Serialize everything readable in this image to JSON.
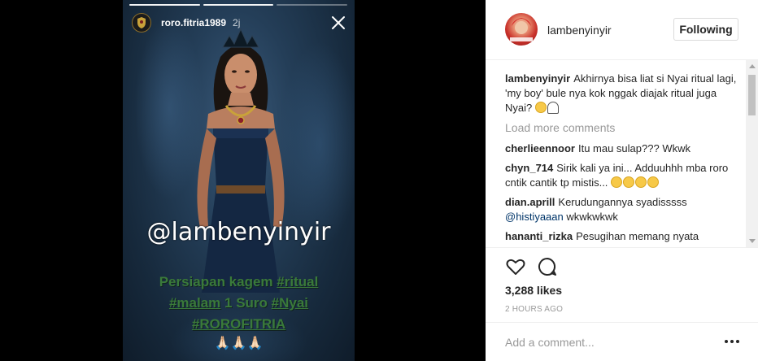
{
  "story": {
    "username": "roro.fitria1989",
    "time": "2j",
    "progress_segments": [
      1,
      1,
      0
    ],
    "overlay_handle": "@lambenyinyir",
    "caption": {
      "line1_prefix": "Persiapan kagem",
      "line1_tag": "#ritual",
      "line2_tag1": "#malam",
      "line2_middle": "1 Suro",
      "line2_tag2": "#Nyai",
      "line3_tag": "#ROROFITRIA"
    },
    "emoji_row": "🙏🏻🙏🏻🙏🏻",
    "icons": {
      "avatar": "police-badge-icon",
      "close": "close-icon"
    }
  },
  "post": {
    "author": "lambenyinyir",
    "follow_label": "Following",
    "caption_user": "lambenyinyir",
    "caption_text": "Akhirnya bisa liat si Nyai ritual lagi, 'my boy' bule nya kok nggak diajak ritual juga Nyai?",
    "load_more": "Load more comments",
    "comments": [
      {
        "user": "cherlieennoor",
        "text": "Itu mau sulap??? Wkwk"
      },
      {
        "user": "chyn_714",
        "text": "Sirik kali ya ini... Adduuhhh mba roro cntik cantik tp mistis..."
      },
      {
        "user": "dian.aprill",
        "text": "Kerudungannya syadisssss",
        "mention": "@histiyaaan",
        "text2": "wkwkwkwk"
      },
      {
        "user": "hananti_rizka",
        "text": "Pesugihan memang nyata"
      }
    ],
    "likes": "3,288 likes",
    "time_ago": "2 HOURS AGO",
    "comment_placeholder": "Add a comment...",
    "icons": {
      "like": "heart-icon",
      "comment": "comment-bubble-icon",
      "more": "more-options-icon"
    }
  }
}
